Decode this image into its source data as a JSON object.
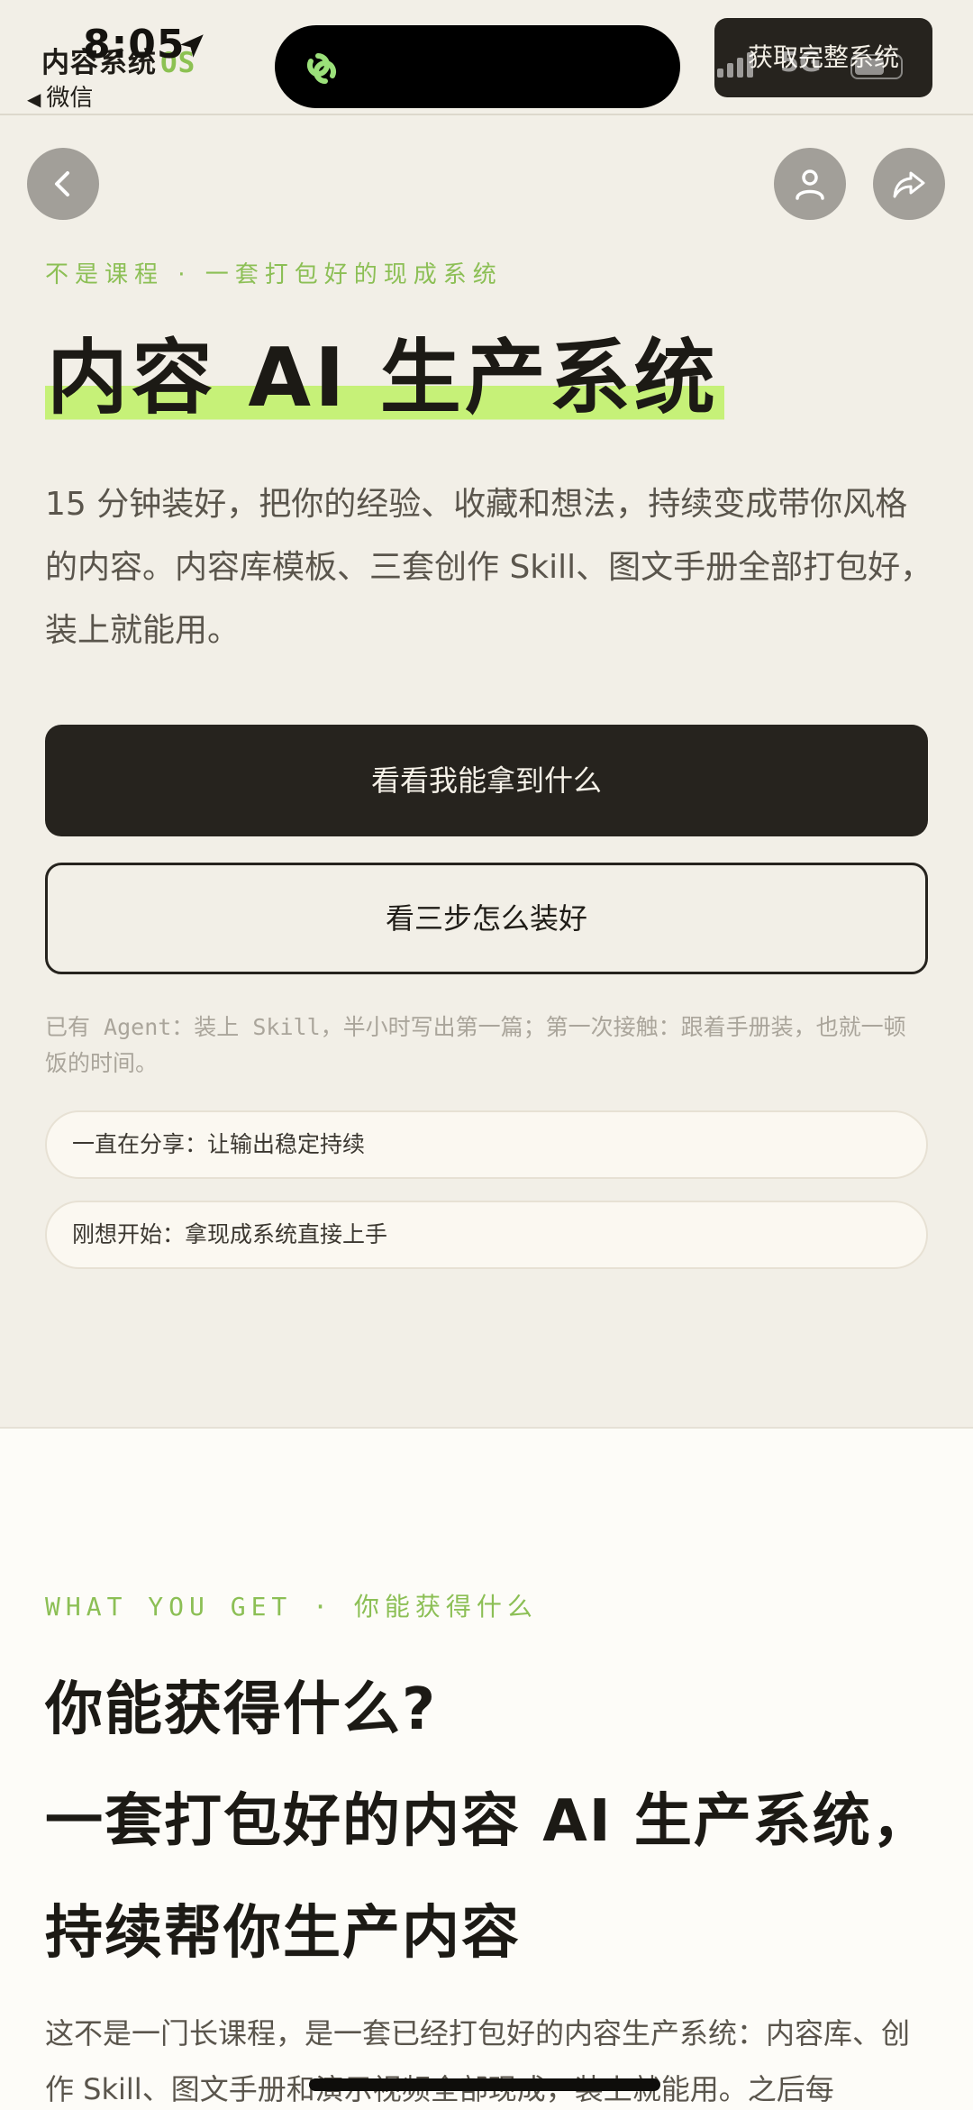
{
  "status_bar": {
    "time": "8:05",
    "back_app": "微信",
    "network": "5G"
  },
  "nav": {
    "brand_name": "内容系统",
    "brand_suffix": "OS",
    "cta": "获取完整系统"
  },
  "hero": {
    "eyebrow": "不是课程 · 一套打包好的现成系统",
    "title": "内容 AI 生产系统",
    "description": "15 分钟装好，把你的经验、收藏和想法，持续变成带你风格的内容。内容库模板、三套创作 Skill、图文手册全部打包好，装上就能用。",
    "primary_button": "看看我能拿到什么",
    "secondary_button": "看三步怎么装好",
    "note": "已有 Agent：装上 Skill，半小时写出第一篇；第一次接触：跟着手册装，也就一顿饭的时间。",
    "pills": [
      {
        "label": "一直在分享：让输出稳定持续"
      },
      {
        "label": "刚想开始：拿现成系统直接上手"
      }
    ]
  },
  "section_get": {
    "eyebrow": "WHAT YOU GET · 你能获得什么",
    "title_line1": "你能获得什么?",
    "title_line2": "一套打包好的内容 AI 生产系统，持续帮你生产内容",
    "description": "这不是一门长课程，是一套已经打包好的内容生产系统：内容库、创作 Skill、图文手册和演示视频全部现成，装上就能用。之后每"
  },
  "colors": {
    "background": "#f2efe7",
    "accent_green": "#8cbf55",
    "highlight": "#c6f178",
    "dark": "#26231e"
  }
}
